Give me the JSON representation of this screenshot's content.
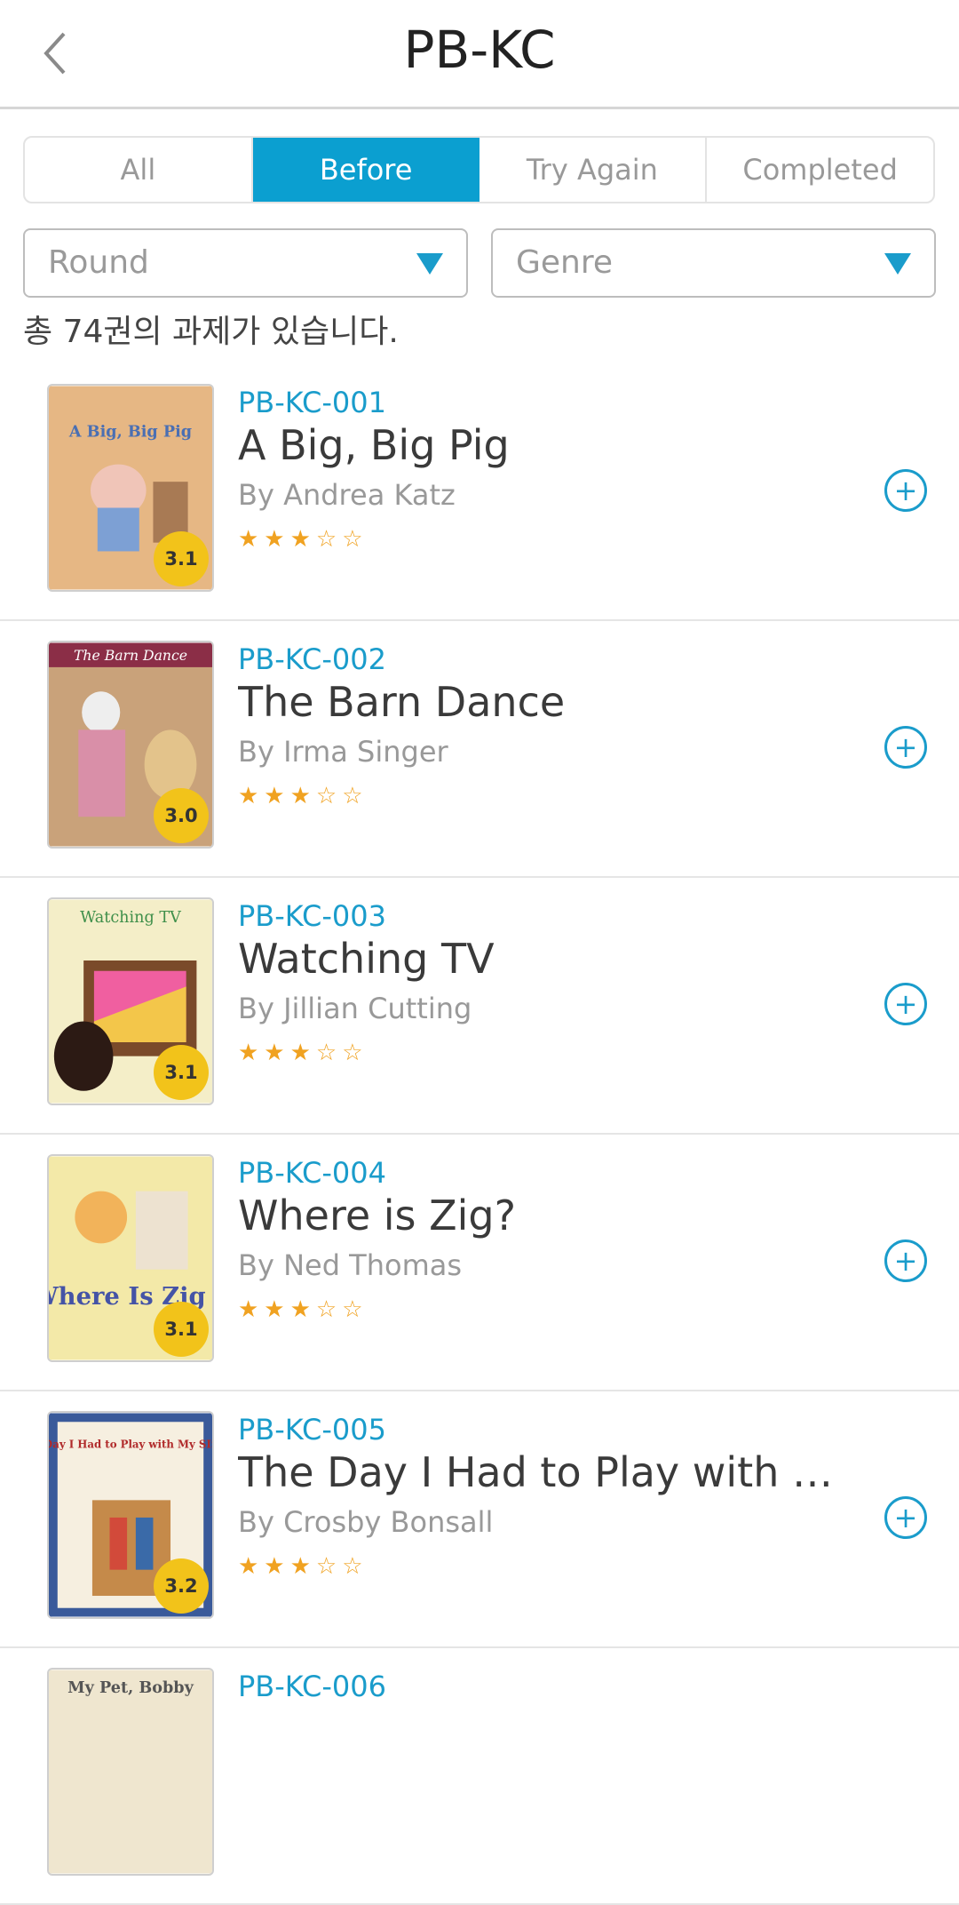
{
  "header": {
    "title": "PB-KC",
    "back_icon": "chevron-left-icon"
  },
  "tabs": [
    {
      "label": "All",
      "active": false
    },
    {
      "label": "Before",
      "active": true
    },
    {
      "label": "Try Again",
      "active": false
    },
    {
      "label": "Completed",
      "active": false
    }
  ],
  "filters": {
    "round": {
      "value": "Round",
      "icon": "triangle-down-icon"
    },
    "genre": {
      "value": "Genre",
      "icon": "triangle-down-icon"
    }
  },
  "count_text": "총 74권의 과제가 있습니다.",
  "accent": "#0b9fd0",
  "books": [
    {
      "code": "PB-KC-001",
      "title": "A Big, Big Pig",
      "author": "By Andrea Katz",
      "level": "3.1",
      "rating": 3,
      "stars": "★★★☆☆"
    },
    {
      "code": "PB-KC-002",
      "title": "The Barn Dance",
      "author": "By Irma Singer",
      "level": "3.0",
      "rating": 3,
      "stars": "★★★☆☆"
    },
    {
      "code": "PB-KC-003",
      "title": "Watching TV",
      "author": "By Jillian Cutting",
      "level": "3.1",
      "rating": 3,
      "stars": "★★★☆☆"
    },
    {
      "code": "PB-KC-004",
      "title": "Where is Zig?",
      "author": "By Ned Thomas",
      "level": "3.1",
      "rating": 3,
      "stars": "★★★☆☆"
    },
    {
      "code": "PB-KC-005",
      "title": "The Day I Had to Play with M…",
      "author": "By Crosby Bonsall",
      "level": "3.2",
      "rating": 3,
      "stars": "★★★☆☆"
    },
    {
      "code": "PB-KC-006",
      "title": "",
      "author": "",
      "level": "",
      "rating": 0,
      "stars": ""
    }
  ],
  "covers": [
    {
      "text": "A Big, Big Pig"
    },
    {
      "text": "The Barn Dance"
    },
    {
      "text": "Watching TV"
    },
    {
      "text": "Where Is Zig"
    },
    {
      "text": "The Day I Had to Play with My SISTER"
    },
    {
      "text": "My Pet, Bobby"
    }
  ]
}
